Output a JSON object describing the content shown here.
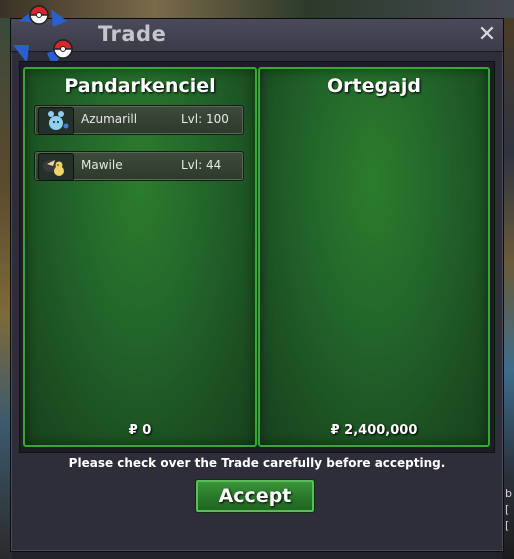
{
  "window": {
    "title": "Trade",
    "close_label": "✕"
  },
  "traders": [
    {
      "name": "Pandarkenciel",
      "money": "₽ 0",
      "pokemon": [
        {
          "name": "Azumarill",
          "level": "Lvl: 100",
          "icon": "azumarill-sprite-icon"
        },
        {
          "name": "Mawile",
          "level": "Lvl: 44",
          "icon": "mawile-sprite-icon"
        }
      ]
    },
    {
      "name": "Ortegajd",
      "money": "₽ 2,400,000",
      "pokemon": []
    }
  ],
  "footer": {
    "note": "Please check over the Trade carefully before accepting.",
    "accept_label": "Accept"
  },
  "colors": {
    "panel_green": "#22662a",
    "panel_border": "#3aa63a",
    "window_bg": "#2e2e3a",
    "accept_green": "#2a7a2a"
  },
  "background": {
    "right_edge_text": "b [ ["
  }
}
